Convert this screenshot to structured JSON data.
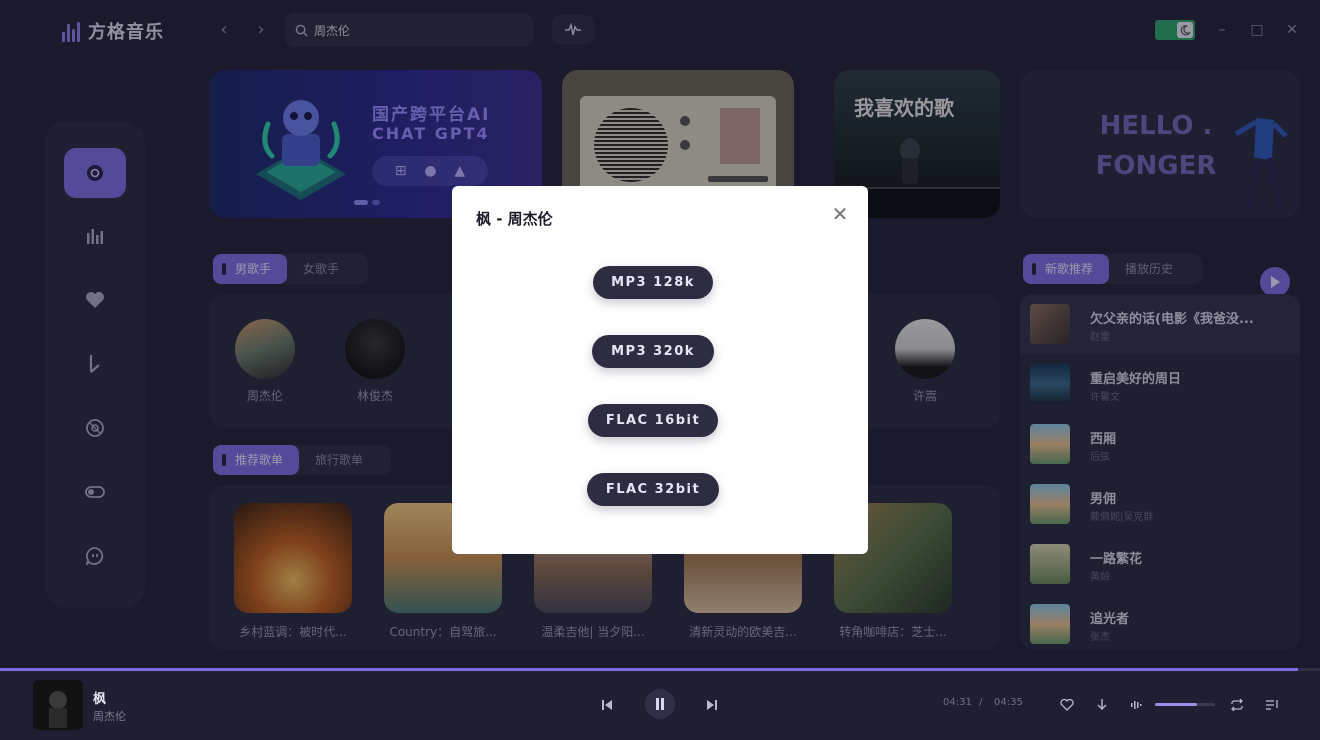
{
  "app": {
    "name": "方格音乐"
  },
  "search": {
    "value": "周杰伦"
  },
  "banners": {
    "ai_line1": "国产跨平台AI",
    "ai_line2": "CHAT GPT4",
    "fav_title": "我喜欢的歌",
    "hello_line1": "HELLO .",
    "hello_line2": "FONGER"
  },
  "artist_tabs": [
    "男歌手",
    "女歌手"
  ],
  "artists": [
    "周杰伦",
    "林俊杰",
    "许嵩"
  ],
  "playlist_tabs": [
    "推荐歌单",
    "旅行歌单"
  ],
  "playlists": [
    "乡村蓝调：被时代...",
    "Country：自驾旅...",
    "温柔吉他| 当夕阳...",
    "清新灵动的欧美吉...",
    "转角咖啡店：芝士..."
  ],
  "song_tabs": [
    "新歌推荐",
    "播放历史"
  ],
  "songs": [
    {
      "title": "欠父亲的话(电影《我爸没...",
      "artist": "赵雷"
    },
    {
      "title": "重启美好的周日",
      "artist": "许馨文"
    },
    {
      "title": "西厢",
      "artist": "后弦"
    },
    {
      "title": "男佣",
      "artist": "戴佩妮|吴克群"
    },
    {
      "title": "一路繁花",
      "artist": "黄龄"
    },
    {
      "title": "追光者",
      "artist": "张杰"
    }
  ],
  "modal": {
    "title": "枫 - 周杰伦",
    "options": [
      "MP3 128k",
      "MP3 320k",
      "FLAC 16bit",
      "FLAC 32bit"
    ]
  },
  "player": {
    "song": "枫",
    "artist": "周杰伦",
    "current": "04:31",
    "separator": "/",
    "total": "04:35",
    "progress_fraction": 0.983,
    "volume_fraction": 0.7
  },
  "colors": {
    "accent": "#7b6de0",
    "background": "#24243a",
    "panel": "#2b2b42"
  },
  "icons": [
    "logo-icon",
    "back-icon",
    "forward-icon",
    "search-icon",
    "waveform-icon",
    "moon-icon",
    "minimize-icon",
    "maximize-icon",
    "close-icon",
    "disc-icon",
    "chart-icon",
    "heart-icon",
    "music-note-icon",
    "vinyl-icon",
    "toggle-icon",
    "chat-icon",
    "play-icon",
    "previous-icon",
    "pause-icon",
    "next-icon",
    "download-icon",
    "volume-icon",
    "repeat-icon",
    "playlist-icon"
  ]
}
